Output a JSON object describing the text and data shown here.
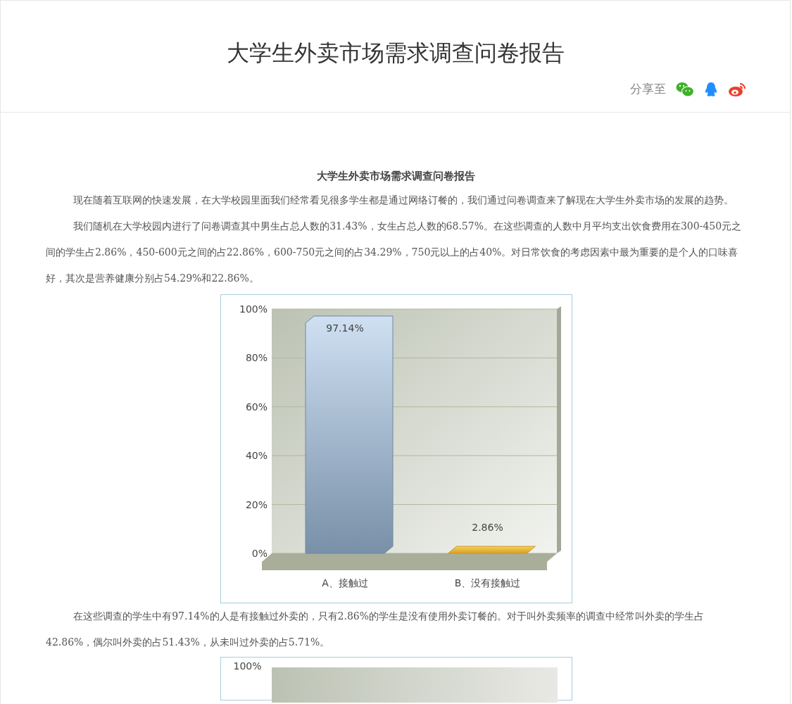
{
  "header": {
    "title": "大学生外卖市场需求调查问卷报告",
    "share_label": "分享至"
  },
  "article": {
    "heading": "大学生外卖市场需求调查问卷报告",
    "paragraphs_before": [
      "现在随着互联网的快速发展，在大学校园里面我们经常看见很多学生都是通过网络订餐的，我们通过问卷调查来了解现在大学生外卖市场的发展的趋势。",
      "我们随机在大学校园内进行了问卷调查其中男生占总人数的31.43%，女生占总人数的68.57%。在这些调查的人数中月平均支出饮食费用在300-450元之间的学生占2.86%，450-600元之间的占22.86%，600-750元之间的占34.29%，750元以上的占40%。对日常饮食的考虑因素中最为重要的是个人的口味喜好，其次是营养健康分别占54.29%和22.86%。"
    ],
    "chart_data": {
      "type": "bar",
      "categories": [
        "A、接触过",
        "B、没有接触过"
      ],
      "series": [
        {
          "values": [
            97.14,
            2.86
          ]
        }
      ],
      "grid": true,
      "ylim": [
        0,
        100
      ],
      "yticks": [
        {
          "value": 0,
          "label": "0%"
        },
        {
          "value": 20,
          "label": "20%"
        },
        {
          "value": 40,
          "label": "40%"
        },
        {
          "value": 60,
          "label": "60%"
        },
        {
          "value": 80,
          "label": "80%"
        },
        {
          "value": 100,
          "label": "100%"
        }
      ],
      "value_labels": [
        "97.14%",
        "2.86%"
      ]
    },
    "paragraphs_after": [
      "在这些调查的学生中有97.14%的人是有接触过外卖的，只有2.86%的学生是没有使用外卖订餐的。对于叫外卖频率的调查中经常叫外卖的学生占42.86%，偶尔叫外卖的占51.43%，从未叫过外卖的占5.71%。"
    ],
    "next_chart": {
      "ytick_label": "100%"
    }
  }
}
